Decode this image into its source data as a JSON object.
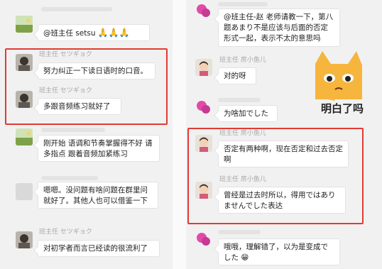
{
  "left": {
    "messages": [
      {
        "name": "",
        "text": "@班主任 setsu",
        "emoji": "🙏🙏🙏"
      },
      {
        "name": "班主任 セツギョク",
        "text": "努力纠正一下读日语时的口音。"
      },
      {
        "name": "班主任 セツギョク",
        "text": "多跟音频练习就好了"
      },
      {
        "name": "",
        "text": "刚开始 语调和节奏掌握得不好 请多指点 跟着音频加紧练习"
      },
      {
        "name": "",
        "text": "嗯嗯。没问题有啥问题在群里问就好了。其他人也可以借鉴一下"
      },
      {
        "name": "班主任 セツギョク",
        "text": "对初学者而言已经读的很流利了"
      }
    ]
  },
  "right": {
    "messages": [
      {
        "name": "",
        "text": "@班主任-赵 老师请教一下，第八题あまり不是应该与后面的否定形式一起，表示不太的意思吗"
      },
      {
        "name": "班主任 房小鱼儿",
        "text": "对的呀"
      },
      {
        "name": "",
        "text": "为啥加でした"
      },
      {
        "name": "班主任 房小鱼儿",
        "text": "否定有两种啊，现在否定和过去否定啊"
      },
      {
        "name": "班主任 房小鱼儿",
        "text": "曾经是过去时所以，得用ではありませんでした表达"
      },
      {
        "name": "",
        "text": "哦哦，理解错了，以为是变成でした",
        "emoji": "😁"
      }
    ],
    "sticker_caption": "明白了吗"
  },
  "colors": {
    "highlight": "#e23a34",
    "bubble": "#ffffff",
    "background": "#f1f1f1"
  }
}
